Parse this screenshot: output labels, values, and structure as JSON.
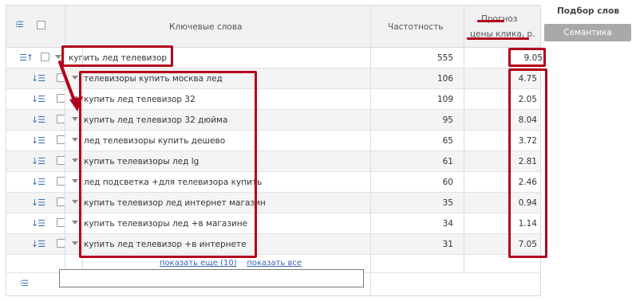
{
  "header": {
    "keywords_label": "Ключевые слова",
    "frequency_label": "Частотность",
    "forecast_line1": "Прогноз",
    "forecast_line2": "цены клика, р."
  },
  "main_row": {
    "keyword": "купить лед телевизор",
    "frequency": "555",
    "price": "9.05"
  },
  "rows": [
    {
      "keyword": "телевизоры купить москва лед",
      "frequency": "106",
      "price": "4.75"
    },
    {
      "keyword": "купить лед телевизор 32",
      "frequency": "109",
      "price": "2.05"
    },
    {
      "keyword": "купить лед телевизор 32 дюйма",
      "frequency": "95",
      "price": "8.04"
    },
    {
      "keyword": "лед телевизоры купить дешево",
      "frequency": "65",
      "price": "3.72"
    },
    {
      "keyword": "купить телевизоры лед lg",
      "frequency": "61",
      "price": "2.81"
    },
    {
      "keyword": "лед подсветка +для телевизора купить",
      "frequency": "60",
      "price": "2.46"
    },
    {
      "keyword": "купить телевизор лед интернет магазин",
      "frequency": "35",
      "price": "0.94"
    },
    {
      "keyword": "купить телевизоры лед +в магазине",
      "frequency": "34",
      "price": "1.14"
    },
    {
      "keyword": "купить лед телевизор +в интернете",
      "frequency": "31",
      "price": "7.05"
    }
  ],
  "footer": {
    "show_more": "показать еще (10)",
    "show_all": "показать все",
    "input_value": ""
  },
  "side_panel": {
    "title": "Подбор слов",
    "semantics_button": "Семантика"
  },
  "icons": {
    "tree_collapse": "tree-collapse-icon",
    "sort_expand": "sort-expand-icon",
    "sort_collapse": "sort-collapse-icon",
    "dropdown": "dropdown-triangle-icon",
    "tree_add": "tree-add-icon"
  },
  "colors": {
    "annotation_red": "#b3001b",
    "link_blue": "#3d64b0",
    "header_bg": "#f1f1f1",
    "button_gray": "#a9a9a9"
  }
}
